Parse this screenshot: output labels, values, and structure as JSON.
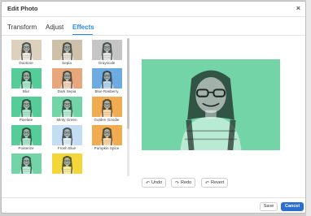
{
  "dialog": {
    "title": "Edit Photo",
    "close_label": "×"
  },
  "tabs": [
    {
      "label": "Transform",
      "active": false
    },
    {
      "label": "Adjust",
      "active": false
    },
    {
      "label": "Effects",
      "active": true
    }
  ],
  "effects": [
    {
      "label": "Duotone",
      "color": "#d9cbb6"
    },
    {
      "label": "Sepia",
      "color": "#c9b89e"
    },
    {
      "label": "Grayscale",
      "color": "#bdbdbd"
    },
    {
      "label": "Blur",
      "color": "#3fc58b"
    },
    {
      "label": "Dark Sepia",
      "color": "#e59a6c"
    },
    {
      "label": "Blue Rasberry",
      "color": "#5aa0e0"
    },
    {
      "label": "Pixelate",
      "color": "#3fc58b"
    },
    {
      "label": "Minty Green",
      "color": "#5fcf9b"
    },
    {
      "label": "Golden Goodie",
      "color": "#f0a13a"
    },
    {
      "label": "Posterize",
      "color": "#3fc58b"
    },
    {
      "label": "Frosh Blue",
      "color": "#bcd9f1"
    },
    {
      "label": "Pumpkin Spice",
      "color": "#f0a13a"
    },
    {
      "label": "",
      "color": "#5fcf9b"
    },
    {
      "label": "",
      "color": "#f2d21f"
    }
  ],
  "preview": {
    "tint": "#5fcf9b"
  },
  "history": {
    "undo": "Undo",
    "redo": "Redo",
    "revert": "Revert"
  },
  "footer": {
    "save": "Save",
    "cancel": "Cancel"
  },
  "colors": {
    "accent": "#2a8ad8",
    "primary_button": "#2a6fd1"
  }
}
